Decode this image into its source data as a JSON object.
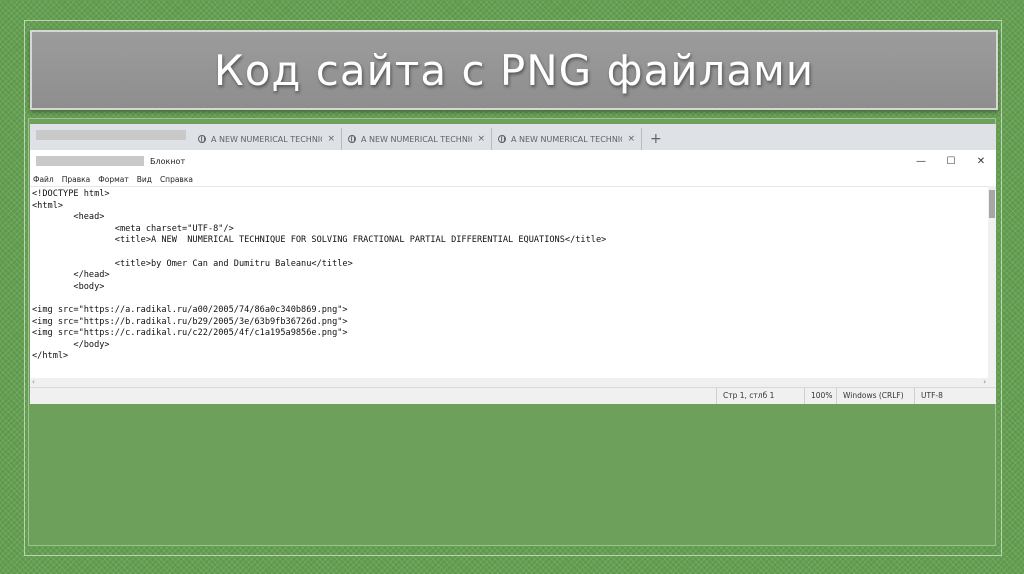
{
  "slide": {
    "title": "Код сайта с PNG файлами"
  },
  "browser": {
    "tabs": [
      {
        "label": "A NEW NUMERICAL TECHNIQUE",
        "close": "×"
      },
      {
        "label": "A NEW NUMERICAL TECHNIQUE",
        "close": "×"
      },
      {
        "label": "A NEW NUMERICAL TECHNIQUE",
        "close": "×"
      }
    ],
    "new_tab": "+"
  },
  "notepad": {
    "title": "Блокнот",
    "controls": {
      "minimize": "—",
      "maximize": "☐",
      "close": "✕"
    },
    "menu": [
      "Файл",
      "Правка",
      "Формат",
      "Вид",
      "Справка"
    ],
    "lines": [
      "<!DOCTYPE html>",
      "<html>",
      "        <head>",
      "                <meta charset=\"UTF-8\"/>",
      "                <title>A NEW  NUMERICAL TECHNIQUE FOR SOLVING FRACTIONAL PARTIAL DIFFERENTIAL EQUATIONS</title>",
      "",
      "                <title>by Omer Can and Dumitru Baleanu</title>",
      "        </head>",
      "        <body>",
      "",
      "<img src=\"https://a.radikal.ru/a00/2005/74/86a0c340b869.png\">",
      "<img src=\"https://b.radikal.ru/b29/2005/3e/63b9fb36726d.png\">",
      "<img src=\"https://c.radikal.ru/c22/2005/4f/c1a195a9856e.png\">",
      "        </body>",
      "</html>"
    ],
    "status": {
      "position": "Стр 1, стлб 1",
      "zoom": "100%",
      "line_endings": "Windows (CRLF)",
      "encoding": "UTF-8"
    },
    "scroll_left": "‹",
    "scroll_right": "›"
  }
}
